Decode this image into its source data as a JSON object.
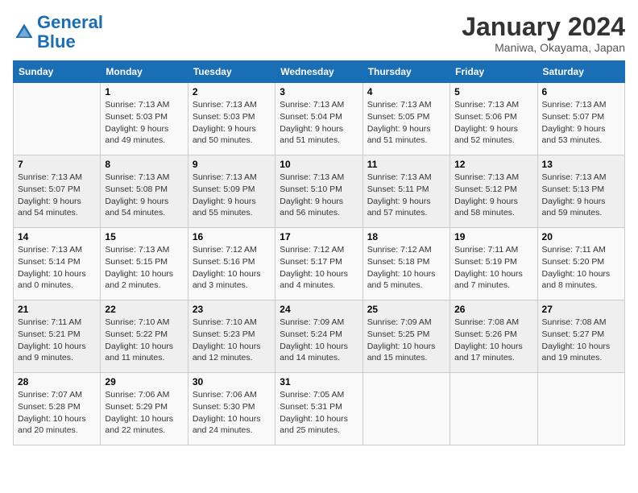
{
  "header": {
    "logo_text_general": "General",
    "logo_text_blue": "Blue",
    "month_title": "January 2024",
    "location": "Maniwa, Okayama, Japan"
  },
  "days_of_week": [
    "Sunday",
    "Monday",
    "Tuesday",
    "Wednesday",
    "Thursday",
    "Friday",
    "Saturday"
  ],
  "weeks": [
    [
      {
        "day": "",
        "info": ""
      },
      {
        "day": "1",
        "info": "Sunrise: 7:13 AM\nSunset: 5:03 PM\nDaylight: 9 hours\nand 49 minutes."
      },
      {
        "day": "2",
        "info": "Sunrise: 7:13 AM\nSunset: 5:03 PM\nDaylight: 9 hours\nand 50 minutes."
      },
      {
        "day": "3",
        "info": "Sunrise: 7:13 AM\nSunset: 5:04 PM\nDaylight: 9 hours\nand 51 minutes."
      },
      {
        "day": "4",
        "info": "Sunrise: 7:13 AM\nSunset: 5:05 PM\nDaylight: 9 hours\nand 51 minutes."
      },
      {
        "day": "5",
        "info": "Sunrise: 7:13 AM\nSunset: 5:06 PM\nDaylight: 9 hours\nand 52 minutes."
      },
      {
        "day": "6",
        "info": "Sunrise: 7:13 AM\nSunset: 5:07 PM\nDaylight: 9 hours\nand 53 minutes."
      }
    ],
    [
      {
        "day": "7",
        "info": "Sunrise: 7:13 AM\nSunset: 5:07 PM\nDaylight: 9 hours\nand 54 minutes."
      },
      {
        "day": "8",
        "info": "Sunrise: 7:13 AM\nSunset: 5:08 PM\nDaylight: 9 hours\nand 54 minutes."
      },
      {
        "day": "9",
        "info": "Sunrise: 7:13 AM\nSunset: 5:09 PM\nDaylight: 9 hours\nand 55 minutes."
      },
      {
        "day": "10",
        "info": "Sunrise: 7:13 AM\nSunset: 5:10 PM\nDaylight: 9 hours\nand 56 minutes."
      },
      {
        "day": "11",
        "info": "Sunrise: 7:13 AM\nSunset: 5:11 PM\nDaylight: 9 hours\nand 57 minutes."
      },
      {
        "day": "12",
        "info": "Sunrise: 7:13 AM\nSunset: 5:12 PM\nDaylight: 9 hours\nand 58 minutes."
      },
      {
        "day": "13",
        "info": "Sunrise: 7:13 AM\nSunset: 5:13 PM\nDaylight: 9 hours\nand 59 minutes."
      }
    ],
    [
      {
        "day": "14",
        "info": "Sunrise: 7:13 AM\nSunset: 5:14 PM\nDaylight: 10 hours\nand 0 minutes."
      },
      {
        "day": "15",
        "info": "Sunrise: 7:13 AM\nSunset: 5:15 PM\nDaylight: 10 hours\nand 2 minutes."
      },
      {
        "day": "16",
        "info": "Sunrise: 7:12 AM\nSunset: 5:16 PM\nDaylight: 10 hours\nand 3 minutes."
      },
      {
        "day": "17",
        "info": "Sunrise: 7:12 AM\nSunset: 5:17 PM\nDaylight: 10 hours\nand 4 minutes."
      },
      {
        "day": "18",
        "info": "Sunrise: 7:12 AM\nSunset: 5:18 PM\nDaylight: 10 hours\nand 5 minutes."
      },
      {
        "day": "19",
        "info": "Sunrise: 7:11 AM\nSunset: 5:19 PM\nDaylight: 10 hours\nand 7 minutes."
      },
      {
        "day": "20",
        "info": "Sunrise: 7:11 AM\nSunset: 5:20 PM\nDaylight: 10 hours\nand 8 minutes."
      }
    ],
    [
      {
        "day": "21",
        "info": "Sunrise: 7:11 AM\nSunset: 5:21 PM\nDaylight: 10 hours\nand 9 minutes."
      },
      {
        "day": "22",
        "info": "Sunrise: 7:10 AM\nSunset: 5:22 PM\nDaylight: 10 hours\nand 11 minutes."
      },
      {
        "day": "23",
        "info": "Sunrise: 7:10 AM\nSunset: 5:23 PM\nDaylight: 10 hours\nand 12 minutes."
      },
      {
        "day": "24",
        "info": "Sunrise: 7:09 AM\nSunset: 5:24 PM\nDaylight: 10 hours\nand 14 minutes."
      },
      {
        "day": "25",
        "info": "Sunrise: 7:09 AM\nSunset: 5:25 PM\nDaylight: 10 hours\nand 15 minutes."
      },
      {
        "day": "26",
        "info": "Sunrise: 7:08 AM\nSunset: 5:26 PM\nDaylight: 10 hours\nand 17 minutes."
      },
      {
        "day": "27",
        "info": "Sunrise: 7:08 AM\nSunset: 5:27 PM\nDaylight: 10 hours\nand 19 minutes."
      }
    ],
    [
      {
        "day": "28",
        "info": "Sunrise: 7:07 AM\nSunset: 5:28 PM\nDaylight: 10 hours\nand 20 minutes."
      },
      {
        "day": "29",
        "info": "Sunrise: 7:06 AM\nSunset: 5:29 PM\nDaylight: 10 hours\nand 22 minutes."
      },
      {
        "day": "30",
        "info": "Sunrise: 7:06 AM\nSunset: 5:30 PM\nDaylight: 10 hours\nand 24 minutes."
      },
      {
        "day": "31",
        "info": "Sunrise: 7:05 AM\nSunset: 5:31 PM\nDaylight: 10 hours\nand 25 minutes."
      },
      {
        "day": "",
        "info": ""
      },
      {
        "day": "",
        "info": ""
      },
      {
        "day": "",
        "info": ""
      }
    ]
  ]
}
